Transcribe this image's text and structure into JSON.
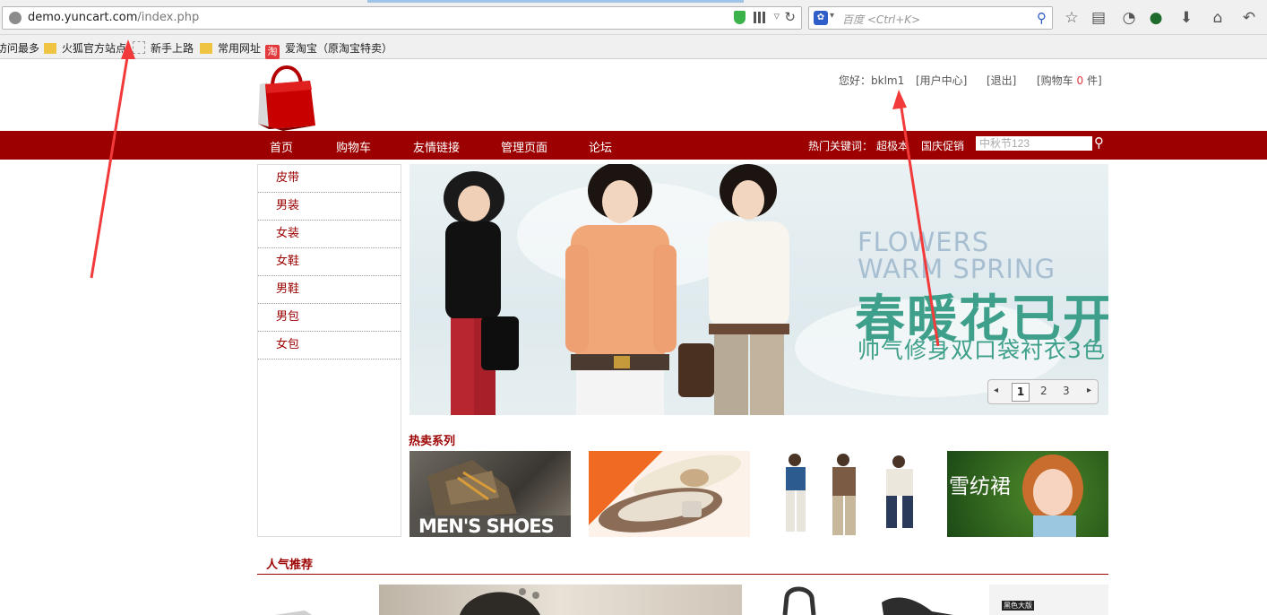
{
  "browser": {
    "url_host": "demo.yuncart.com",
    "url_path": "/index.php",
    "search_placeholder": "百度 <Ctrl+K>",
    "bookmarks": [
      {
        "label": "访问最多",
        "icon": "none"
      },
      {
        "label": "火狐官方站点",
        "icon": "folder-icon"
      },
      {
        "label": "新手上路",
        "icon": "dotted-page-icon"
      },
      {
        "label": "常用网址",
        "icon": "folder-icon"
      },
      {
        "label": "爱淘宝（原淘宝特卖）",
        "icon": "taobao-icon"
      }
    ],
    "toolbar_icons": [
      "star-icon",
      "reading-list-icon",
      "palette-icon",
      "shield-addon-icon",
      "download-icon",
      "home-icon",
      "back-icon"
    ]
  },
  "header": {
    "greeting": "您好：bklm1",
    "user_center": "[用户中心]",
    "logout": "[退出]",
    "cart_prefix": "[购物车 ",
    "cart_count": "0",
    "cart_suffix": " 件]"
  },
  "nav": {
    "items": [
      "首页",
      "购物车",
      "友情链接",
      "管理页面",
      "论坛"
    ],
    "hot_label": "热门关键词：",
    "hot_keywords": [
      "超极本",
      "国庆促销"
    ],
    "search_value": "中秋节123"
  },
  "sidebar": {
    "categories": [
      "皮带",
      "男装",
      "女装",
      "女鞋",
      "男鞋",
      "男包",
      "女包"
    ]
  },
  "banner": {
    "en_line1": "FLOWERS",
    "en_line2": "WARM SPRING",
    "cn_title": "春暖花已开",
    "cn_sub": "帅气修身双口袋衬衣3色",
    "pages": [
      "1",
      "2",
      "3"
    ],
    "current_page": "1",
    "prev_symbol": "◂",
    "next_symbol": "▸"
  },
  "hot_series": {
    "title": "热卖系列",
    "thumb1_text": "MEN'S SHOES",
    "thumb4_text": "雪纺裙"
  },
  "recommend": {
    "title": "人气推荐",
    "tag_text": "黑色大版"
  },
  "colors": {
    "brand_red": "#9c0000",
    "accent_red": "#e4393c",
    "banner_teal": "#3ea08a"
  }
}
